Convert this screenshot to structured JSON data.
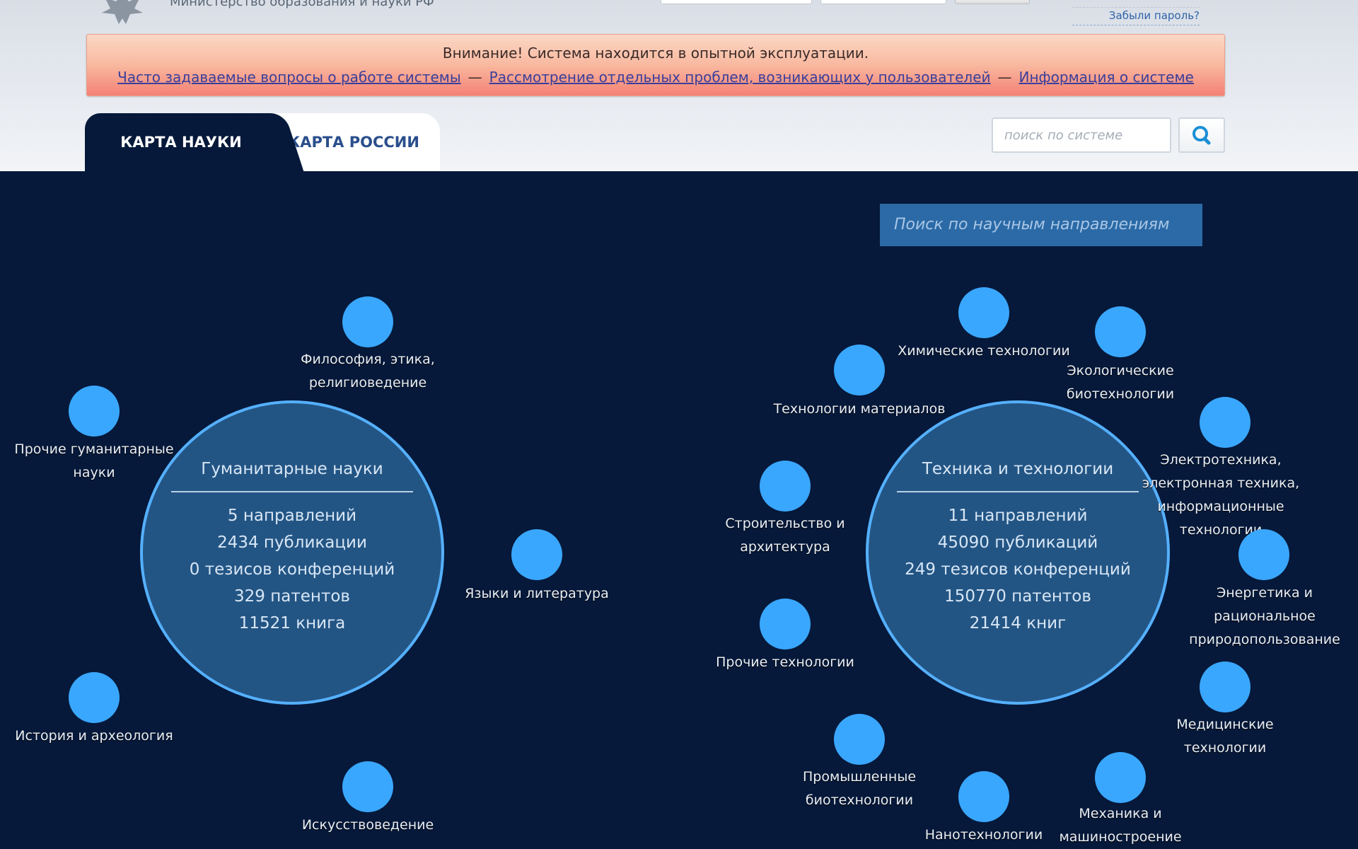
{
  "header": {
    "ministry_text": "Министерство образования и науки РФ",
    "forgot_password": "Забыли пароль?"
  },
  "notice": {
    "title": "Внимание! Система находится в опытной эксплуатации.",
    "links": [
      "Часто задаваемые вопросы о работе системы",
      "Рассмотрение отдельных проблем, возникающих у пользователей",
      "Информация о системе"
    ],
    "separator": "—"
  },
  "tabs": [
    "КАРТА НАУКИ",
    "КАРТА РОССИИ"
  ],
  "search": {
    "placeholder": "поиск по системе"
  },
  "direction_search": "Поиск по научным направлениям",
  "colors": {
    "background": "#06193a",
    "node": "#3aa7ff",
    "hub_fill": "#235584",
    "hub_border": "#55b0ff",
    "notice_gradient_end": "#f48174"
  },
  "humanities": {
    "title": "Гуманитарные науки",
    "stats": [
      "5 направлений",
      "2434 публикации",
      "0 тезисов конференций",
      "329 патентов",
      "11521 книга"
    ],
    "nodes": [
      "Философия, этика, религиоведение",
      "Языки и литература",
      "Искусствоведение",
      "История и археология",
      "Прочие гуманитарные науки"
    ]
  },
  "technology": {
    "title": "Техника и технологии",
    "stats": [
      "11 направлений",
      "45090 публикаций",
      "249 тезисов конференций",
      "150770 патентов",
      "21414 книг"
    ],
    "nodes": [
      "Химические технологии",
      "Экологические биотехнологии",
      "Электротехника, электронная техника, информационные технологии",
      "Энергетика и рациональное природопользование",
      "Медицинские технологии",
      "Механика и машиностроение",
      "Нанотехнологии",
      "Промышленные биотехнологии",
      "Прочие технологии",
      "Строительство и архитектура",
      "Технологии материалов"
    ]
  }
}
